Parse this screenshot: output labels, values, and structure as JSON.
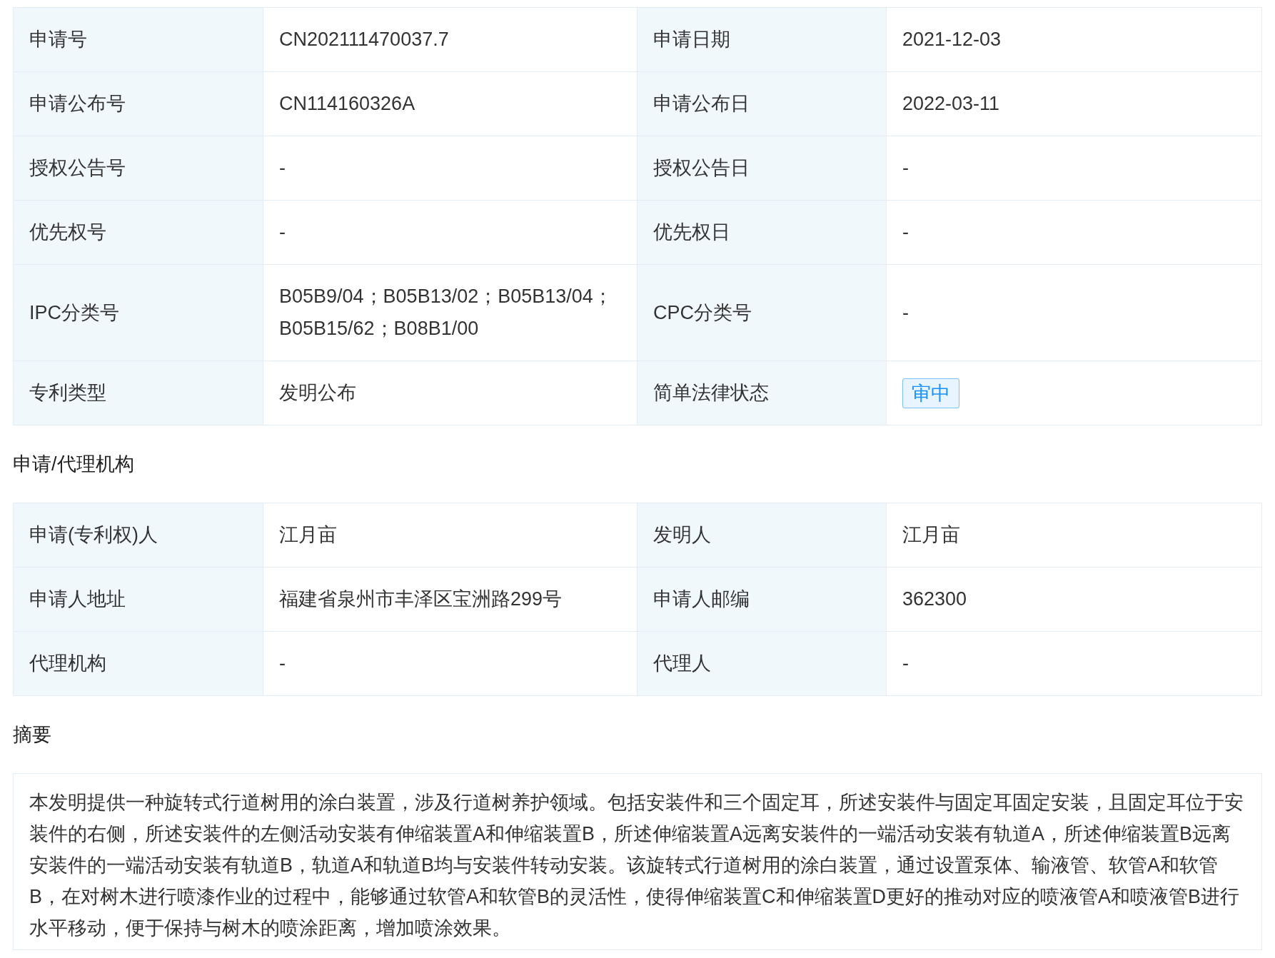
{
  "basic_info": {
    "rows": [
      {
        "items": [
          {
            "label": "申请号",
            "value": "CN202111470037.7",
            "kind": "text"
          },
          {
            "label": "申请日期",
            "value": "2021-12-03",
            "kind": "text"
          }
        ]
      },
      {
        "items": [
          {
            "label": "申请公布号",
            "value": "CN114160326A",
            "kind": "text"
          },
          {
            "label": "申请公布日",
            "value": "2022-03-11",
            "kind": "text"
          }
        ]
      },
      {
        "items": [
          {
            "label": "授权公告号",
            "value": "-",
            "kind": "text"
          },
          {
            "label": "授权公告日",
            "value": "-",
            "kind": "text"
          }
        ]
      },
      {
        "items": [
          {
            "label": "优先权号",
            "value": "-",
            "kind": "text"
          },
          {
            "label": "优先权日",
            "value": "-",
            "kind": "text"
          }
        ]
      },
      {
        "items": [
          {
            "label": "IPC分类号",
            "value": "B05B9/04；B05B13/02；B05B13/04；B05B15/62；B08B1/00",
            "kind": "text"
          },
          {
            "label": "CPC分类号",
            "value": "-",
            "kind": "text"
          }
        ]
      },
      {
        "items": [
          {
            "label": "专利类型",
            "value": "发明公布",
            "kind": "text"
          },
          {
            "label": "简单法律状态",
            "value": "审中",
            "kind": "tag"
          }
        ]
      }
    ]
  },
  "agency": {
    "title": "申请/代理机构",
    "rows": [
      {
        "items": [
          {
            "label": "申请(专利权)人",
            "value": "江月亩",
            "kind": "text"
          },
          {
            "label": "发明人",
            "value": "江月亩",
            "kind": "text"
          }
        ]
      },
      {
        "items": [
          {
            "label": "申请人地址",
            "value": "福建省泉州市丰泽区宝洲路299号",
            "kind": "text"
          },
          {
            "label": "申请人邮编",
            "value": "362300",
            "kind": "text"
          }
        ]
      },
      {
        "items": [
          {
            "label": "代理机构",
            "value": "-",
            "kind": "text"
          },
          {
            "label": "代理人",
            "value": "-",
            "kind": "text"
          }
        ]
      }
    ]
  },
  "abstract": {
    "title": "摘要",
    "text": "本发明提供一种旋转式行道树用的涂白装置，涉及行道树养护领域。包括安装件和三个固定耳，所述安装件与固定耳固定安装，且固定耳位于安装件的右侧，所述安装件的左侧活动安装有伸缩装置A和伸缩装置B，所述伸缩装置A远离安装件的一端活动安装有轨道A，所述伸缩装置B远离安装件的一端活动安装有轨道B，轨道A和轨道B均与安装件转动安装。该旋转式行道树用的涂白装置，通过设置泵体、输液管、软管A和软管B，在对树木进行喷漆作业的过程中，能够通过软管A和软管B的灵活性，使得伸缩装置C和伸缩装置D更好的推动对应的喷液管A和喷液管B进行水平移动，便于保持与树木的喷涂距离，增加喷涂效果。"
  }
}
